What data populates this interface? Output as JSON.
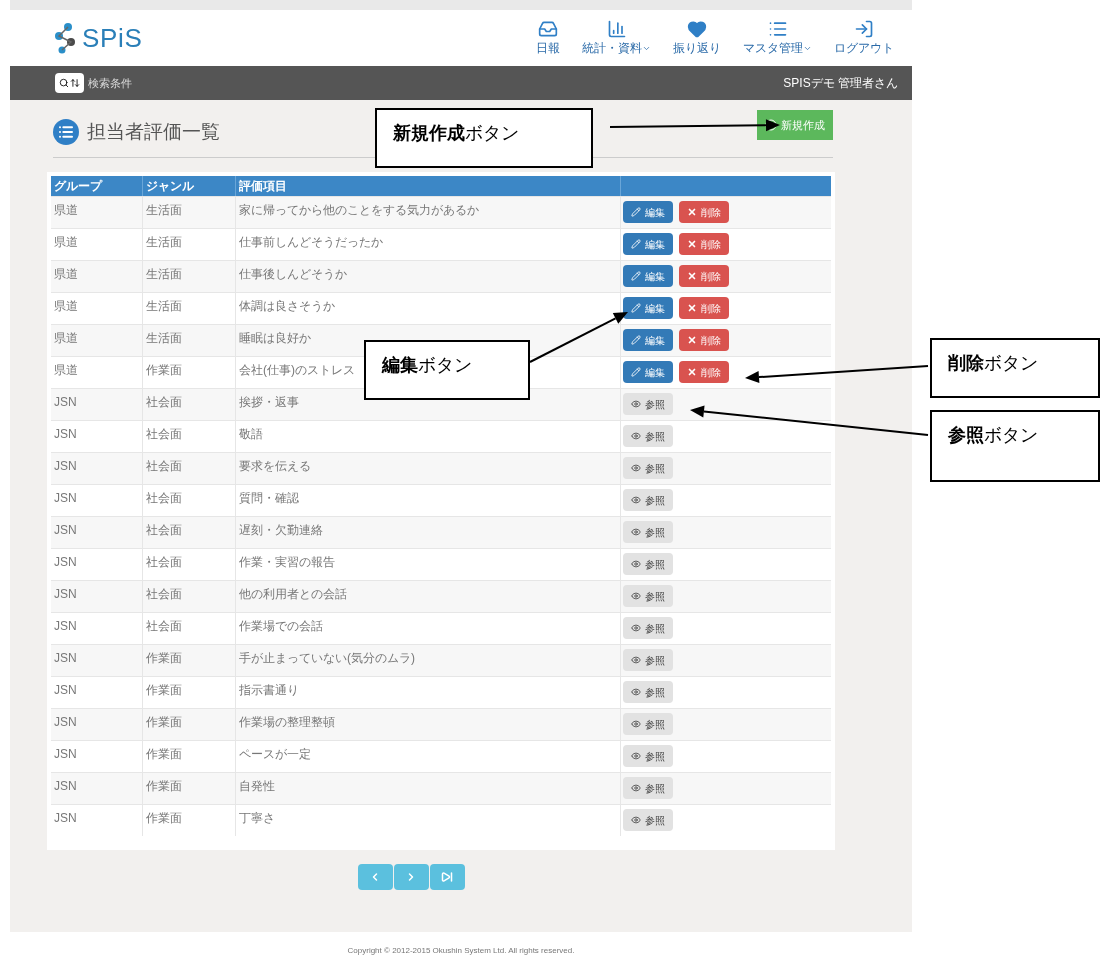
{
  "header": {
    "logo": "SPiS",
    "nav": [
      {
        "label": "日報",
        "caret": false
      },
      {
        "label": "統計・資料",
        "caret": true
      },
      {
        "label": "振り返り",
        "caret": false
      },
      {
        "label": "マスタ管理",
        "caret": true
      },
      {
        "label": "ログアウト",
        "caret": false
      }
    ]
  },
  "toolbar": {
    "search_button": "検索条件",
    "user": "SPISデモ 管理者さん"
  },
  "page": {
    "title": "担当者評価一覧",
    "new_button": "新規作成"
  },
  "table": {
    "columns": [
      "グループ",
      "ジャンル",
      "評価項目"
    ],
    "rows": [
      {
        "group": "県道",
        "genre": "生活面",
        "item": "家に帰ってから他のことをする気力があるか",
        "buttons": [
          {
            "kind": "edit",
            "label": "編集"
          },
          {
            "kind": "delete",
            "label": "削除"
          }
        ]
      },
      {
        "group": "県道",
        "genre": "生活面",
        "item": "仕事前しんどそうだったか",
        "buttons": [
          {
            "kind": "edit",
            "label": "編集"
          },
          {
            "kind": "delete",
            "label": "削除"
          }
        ]
      },
      {
        "group": "県道",
        "genre": "生活面",
        "item": "仕事後しんどそうか",
        "buttons": [
          {
            "kind": "edit",
            "label": "編集"
          },
          {
            "kind": "delete",
            "label": "削除"
          }
        ]
      },
      {
        "group": "県道",
        "genre": "生活面",
        "item": "体調は良さそうか",
        "buttons": [
          {
            "kind": "edit",
            "label": "編集"
          },
          {
            "kind": "delete",
            "label": "削除"
          }
        ]
      },
      {
        "group": "県道",
        "genre": "生活面",
        "item": "睡眠は良好か",
        "buttons": [
          {
            "kind": "edit",
            "label": "編集"
          },
          {
            "kind": "delete",
            "label": "削除"
          }
        ]
      },
      {
        "group": "県道",
        "genre": "作業面",
        "item": "会社(仕事)のストレス",
        "buttons": [
          {
            "kind": "edit",
            "label": "編集"
          },
          {
            "kind": "delete",
            "label": "削除"
          }
        ]
      },
      {
        "group": "JSN",
        "genre": "社会面",
        "item": "挨拶・返事",
        "buttons": [
          {
            "kind": "view",
            "label": "参照"
          }
        ]
      },
      {
        "group": "JSN",
        "genre": "社会面",
        "item": "敬語",
        "buttons": [
          {
            "kind": "view",
            "label": "参照"
          }
        ]
      },
      {
        "group": "JSN",
        "genre": "社会面",
        "item": "要求を伝える",
        "buttons": [
          {
            "kind": "view",
            "label": "参照"
          }
        ]
      },
      {
        "group": "JSN",
        "genre": "社会面",
        "item": "質問・確認",
        "buttons": [
          {
            "kind": "view",
            "label": "参照"
          }
        ]
      },
      {
        "group": "JSN",
        "genre": "社会面",
        "item": "遅刻・欠勤連絡",
        "buttons": [
          {
            "kind": "view",
            "label": "参照"
          }
        ]
      },
      {
        "group": "JSN",
        "genre": "社会面",
        "item": "作業・実習の報告",
        "buttons": [
          {
            "kind": "view",
            "label": "参照"
          }
        ]
      },
      {
        "group": "JSN",
        "genre": "社会面",
        "item": "他の利用者との会話",
        "buttons": [
          {
            "kind": "view",
            "label": "参照"
          }
        ]
      },
      {
        "group": "JSN",
        "genre": "社会面",
        "item": "作業場での会話",
        "buttons": [
          {
            "kind": "view",
            "label": "参照"
          }
        ]
      },
      {
        "group": "JSN",
        "genre": "作業面",
        "item": "手が止まっていない(気分のムラ)",
        "buttons": [
          {
            "kind": "view",
            "label": "参照"
          }
        ]
      },
      {
        "group": "JSN",
        "genre": "作業面",
        "item": "指示書通り",
        "buttons": [
          {
            "kind": "view",
            "label": "参照"
          }
        ]
      },
      {
        "group": "JSN",
        "genre": "作業面",
        "item": "作業場の整理整頓",
        "buttons": [
          {
            "kind": "view",
            "label": "参照"
          }
        ]
      },
      {
        "group": "JSN",
        "genre": "作業面",
        "item": "ペースが一定",
        "buttons": [
          {
            "kind": "view",
            "label": "参照"
          }
        ]
      },
      {
        "group": "JSN",
        "genre": "作業面",
        "item": "自発性",
        "buttons": [
          {
            "kind": "view",
            "label": "参照"
          }
        ]
      },
      {
        "group": "JSN",
        "genre": "作業面",
        "item": "丁寧さ",
        "buttons": [
          {
            "kind": "view",
            "label": "参照"
          }
        ]
      }
    ]
  },
  "pagination": [
    {
      "kind": "prev"
    },
    {
      "kind": "next"
    },
    {
      "kind": "last"
    }
  ],
  "footer": "Copyright © 2012-2015 Okushin System Ltd. All rights reserved.",
  "annotations": [
    {
      "label": "**新規作成**ボタン"
    },
    {
      "label": "**編集**ボタン"
    },
    {
      "label": "**削除**ボタン"
    },
    {
      "label": "**参照**ボタン"
    }
  ]
}
